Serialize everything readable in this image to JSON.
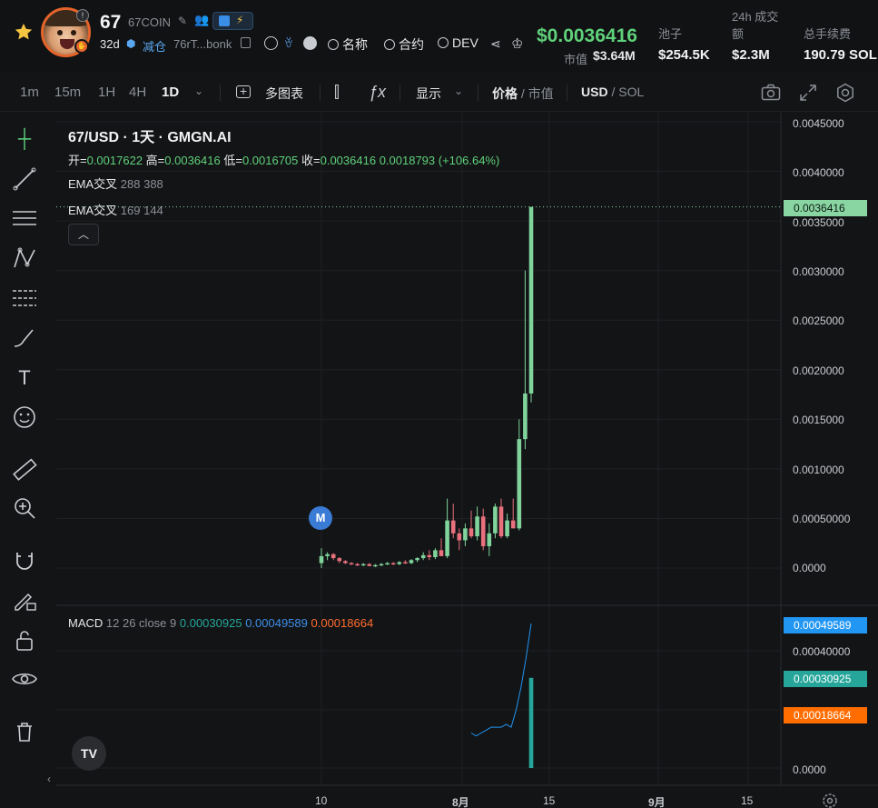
{
  "header": {
    "symbol": "67",
    "name": "67COIN",
    "age": "32d",
    "reduce_label": "减仓",
    "address": "76rT...bonk",
    "search_name": "名称",
    "search_contract": "合约",
    "search_dev": "DEV",
    "price": "$0.0036416",
    "mcap_label": "市值",
    "mcap_value": "$3.64M",
    "pool_label": "池子",
    "pool_value": "$254.5K",
    "vol_label_1": "24h 成交",
    "vol_label_2": "额",
    "vol_value": "$2.3M",
    "fee_label": "总手续费",
    "fee_value": "190.79 SOL"
  },
  "toolbar": {
    "intervals": [
      "1m",
      "15m",
      "1H",
      "4H",
      "1D"
    ],
    "active_interval": "1D",
    "multi_chart": "多图表",
    "display": "显示",
    "price_label": "价格",
    "mcap_label": "市值",
    "usd_label": "USD",
    "sol_label": "SOL"
  },
  "chart": {
    "title": "67/USD · 1天 · GMGN.AI",
    "open_label": "开=",
    "open": "0.0017622",
    "high_label": "高=",
    "high": "0.0036416",
    "low_label": "低=",
    "low": "0.0016705",
    "close_label": "收=",
    "close": "0.0036416",
    "change": "0.0018793 (+106.64%)",
    "ema1_label": "EMA交叉",
    "ema1_params": "288 388",
    "ema2_label": "EMA交叉",
    "ema2_params": "169 144",
    "macd_label": "MACD",
    "macd_params": "12 26 close 9",
    "macd_v1": "0.00030925",
    "macd_v2": "0.00049589",
    "macd_v3": "0.00018664",
    "price_axis": [
      "0.0045000",
      "0.0040000",
      "0.0035000",
      "0.0030000",
      "0.0025000",
      "0.0020000",
      "0.0015000",
      "0.0010000",
      "0.00050000",
      "0.0000"
    ],
    "macd_axis": [
      "0.00040000",
      "0.0000"
    ],
    "last_price_tag": "0.0036416",
    "macd_tag_blue": "0.00049589",
    "macd_tag_teal": "0.00030925",
    "macd_tag_orange": "0.00018664",
    "x_labels": [
      "10",
      "8月",
      "15",
      "9月",
      "15"
    ],
    "marker": "M"
  },
  "chart_data": {
    "type": "candlestick",
    "title": "67/USD · 1天 · GMGN.AI",
    "ylim": [
      0,
      0.0045
    ],
    "candles": [
      {
        "o": 5e-05,
        "h": 0.0002,
        "l": 0.0,
        "c": 0.00012
      },
      {
        "o": 0.00012,
        "h": 0.00016,
        "l": 8e-05,
        "c": 0.00014
      },
      {
        "o": 0.00014,
        "h": 0.00015,
        "l": 8e-05,
        "c": 0.0001
      },
      {
        "o": 0.0001,
        "h": 0.00011,
        "l": 5e-05,
        "c": 7e-05
      },
      {
        "o": 7e-05,
        "h": 8e-05,
        "l": 4e-05,
        "c": 5e-05
      },
      {
        "o": 5e-05,
        "h": 6e-05,
        "l": 3e-05,
        "c": 4e-05
      },
      {
        "o": 4e-05,
        "h": 5e-05,
        "l": 2e-05,
        "c": 3e-05
      },
      {
        "o": 3e-05,
        "h": 5e-05,
        "l": 2e-05,
        "c": 4e-05
      },
      {
        "o": 4e-05,
        "h": 5e-05,
        "l": 2e-05,
        "c": 2e-05
      },
      {
        "o": 2e-05,
        "h": 4e-05,
        "l": 1e-05,
        "c": 3e-05
      },
      {
        "o": 3e-05,
        "h": 5e-05,
        "l": 2e-05,
        "c": 4e-05
      },
      {
        "o": 4e-05,
        "h": 6e-05,
        "l": 3e-05,
        "c": 5e-05
      },
      {
        "o": 5e-05,
        "h": 6e-05,
        "l": 3e-05,
        "c": 4e-05
      },
      {
        "o": 4e-05,
        "h": 7e-05,
        "l": 3e-05,
        "c": 6e-05
      },
      {
        "o": 6e-05,
        "h": 8e-05,
        "l": 4e-05,
        "c": 5e-05
      },
      {
        "o": 5e-05,
        "h": 9e-05,
        "l": 4e-05,
        "c": 8e-05
      },
      {
        "o": 8e-05,
        "h": 0.00011,
        "l": 6e-05,
        "c": 0.0001
      },
      {
        "o": 0.0001,
        "h": 0.00016,
        "l": 8e-05,
        "c": 0.00013
      },
      {
        "o": 0.00013,
        "h": 0.00018,
        "l": 8e-05,
        "c": 0.00011
      },
      {
        "o": 0.00011,
        "h": 0.0002,
        "l": 9e-05,
        "c": 0.00018
      },
      {
        "o": 0.00018,
        "h": 0.0003,
        "l": 0.00012,
        "c": 0.00012
      },
      {
        "o": 0.00012,
        "h": 0.0007,
        "l": 0.0001,
        "c": 0.00048
      },
      {
        "o": 0.00048,
        "h": 0.00065,
        "l": 0.0003,
        "c": 0.00035
      },
      {
        "o": 0.00035,
        "h": 0.0004,
        "l": 0.00018,
        "c": 0.00028
      },
      {
        "o": 0.00028,
        "h": 0.00045,
        "l": 0.00022,
        "c": 0.0004
      },
      {
        "o": 0.0004,
        "h": 0.00058,
        "l": 0.0003,
        "c": 0.00032
      },
      {
        "o": 0.00032,
        "h": 0.00062,
        "l": 0.00028,
        "c": 0.00052
      },
      {
        "o": 0.00052,
        "h": 0.0006,
        "l": 0.00018,
        "c": 0.00022
      },
      {
        "o": 0.00022,
        "h": 0.00045,
        "l": 0.00012,
        "c": 0.00035
      },
      {
        "o": 0.00035,
        "h": 0.00065,
        "l": 0.0003,
        "c": 0.00062
      },
      {
        "o": 0.00062,
        "h": 0.0007,
        "l": 0.0003,
        "c": 0.00032
      },
      {
        "o": 0.00032,
        "h": 0.00055,
        "l": 0.0003,
        "c": 0.00048
      },
      {
        "o": 0.00048,
        "h": 0.0007,
        "l": 0.0004,
        "c": 0.0004
      },
      {
        "o": 0.0004,
        "h": 0.0015,
        "l": 0.00038,
        "c": 0.0013
      },
      {
        "o": 0.0013,
        "h": 0.003,
        "l": 0.0012,
        "c": 0.00176
      },
      {
        "o": 0.00176,
        "h": 0.0036416,
        "l": 0.00167,
        "c": 0.0036416
      }
    ],
    "macd_ylim": [
      0,
      0.00058
    ],
    "macd_hist": [
      0.0,
      0.0,
      0.0,
      0.0,
      0.0,
      0.0,
      0.0,
      0.0,
      0.0,
      0.0,
      0.0,
      0.0,
      0.0,
      0.0,
      0.0,
      0.0,
      0.0,
      0.0,
      0.0,
      0.0,
      0.0,
      0.0,
      0.0,
      0.0,
      0.0,
      0.0,
      0.0,
      0.0,
      0.0,
      0.0,
      0.0,
      0.0,
      0.0,
      0.0,
      0.0,
      0.00030925
    ],
    "macd_line": [
      0.00012,
      0.00011,
      0.00012,
      0.00013,
      0.00014,
      0.00014,
      0.00014,
      0.00015,
      0.00014,
      0.0002,
      0.00028,
      0.00038,
      0.00049589
    ],
    "colors": {
      "up": "#7fd39b",
      "down": "#e8717d",
      "macd_hist": "#26a69a",
      "macd_line": "#2196f3"
    }
  }
}
